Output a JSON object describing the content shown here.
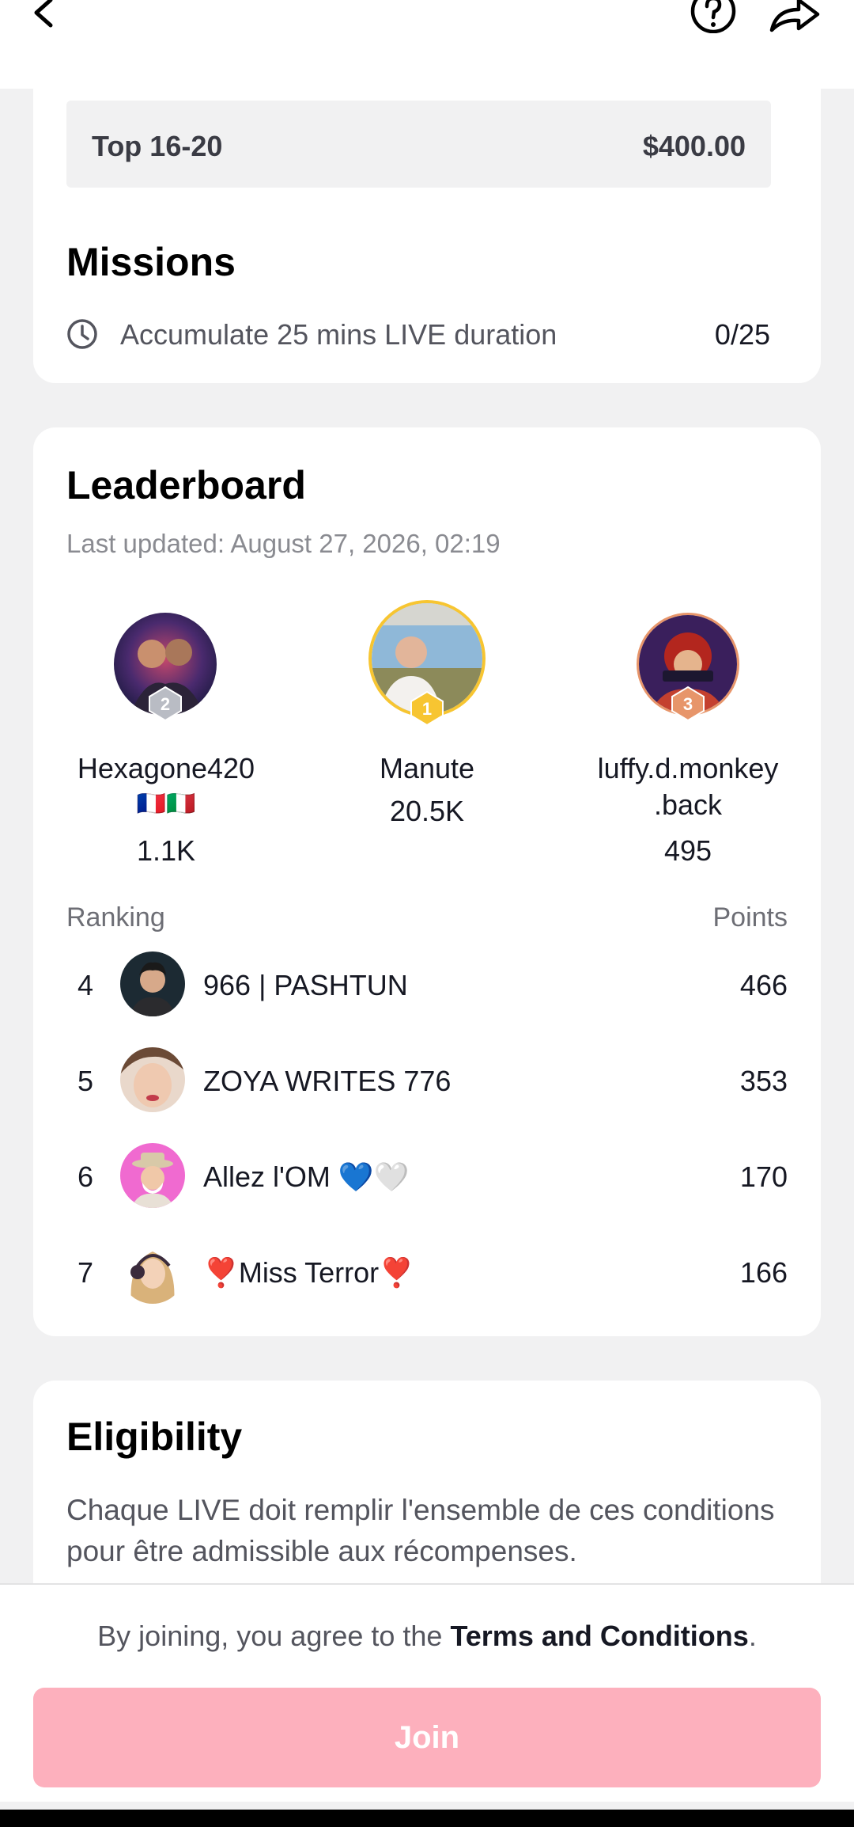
{
  "header": {
    "back_icon": "chevron-left-icon",
    "help_icon": "question-circle-icon",
    "share_icon": "share-arrow-icon"
  },
  "rewards": {
    "rank_range": "Top 16-20",
    "amount": "$400.00"
  },
  "missions": {
    "title": "Missions",
    "items": [
      {
        "icon": "clock-icon",
        "text": "Accumulate 25 mins LIVE duration",
        "progress": "0/25"
      }
    ]
  },
  "leaderboard": {
    "title": "Leaderboard",
    "last_updated": "Last updated: August 27, 2026, 02:19",
    "podium": [
      {
        "rank": "2",
        "name": "Hexagone420",
        "flags": "🇫🇷🇮🇹",
        "points": "1.1K",
        "badge_color": "#b9bcc4"
      },
      {
        "rank": "1",
        "name": "Manute",
        "points": "20.5K",
        "badge_color": "#f7c531"
      },
      {
        "rank": "3",
        "name": "luffy.d.monkey",
        "name_line2": ".back",
        "points": "495",
        "badge_color": "#e7956a"
      }
    ],
    "ranking_label": "Ranking",
    "points_label": "Points",
    "rows": [
      {
        "rank": "4",
        "name": "966 | PASHTUN",
        "points": "466"
      },
      {
        "rank": "5",
        "name": "ZOYA WRITES 776",
        "points": "353"
      },
      {
        "rank": "6",
        "name": "Allez l'OM 💙🤍",
        "points": "170"
      },
      {
        "rank": "7",
        "name": "❣️Miss Terror❣️",
        "points": "166"
      }
    ]
  },
  "eligibility": {
    "title": "Eligibility",
    "text": "Chaque LIVE doit remplir l'ensemble de ces conditions pour être admissible aux récompenses."
  },
  "footer": {
    "terms_prefix": "By joining, you agree to the ",
    "terms_link": "Terms and Conditions",
    "terms_suffix": ".",
    "join_label": "Join",
    "join_color": "#fdb0bd"
  }
}
